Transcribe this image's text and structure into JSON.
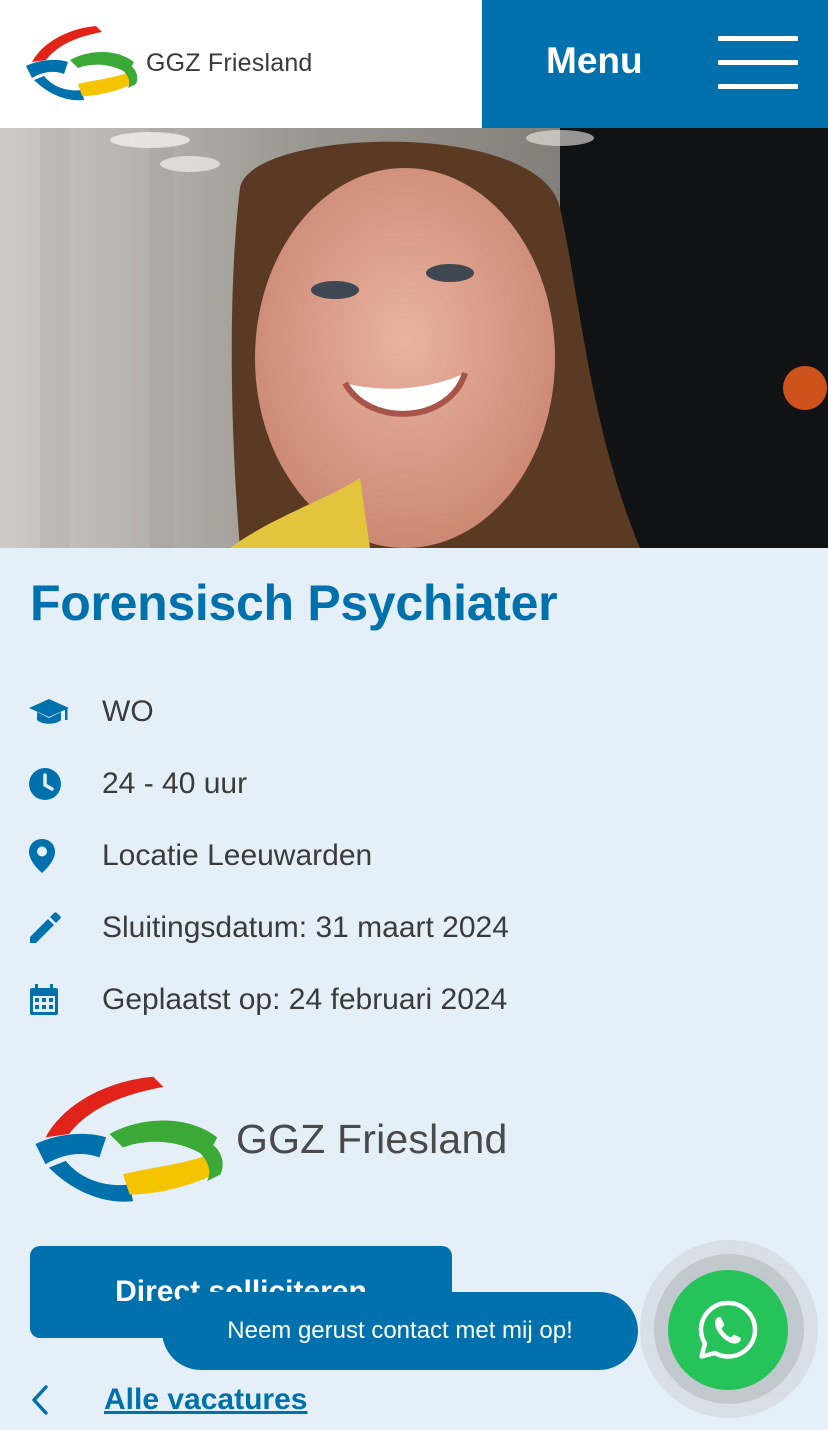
{
  "header": {
    "brand_name": "GGZ Friesland",
    "menu_label": "Menu"
  },
  "hero": {
    "image_description": "smiling-woman-portrait"
  },
  "job": {
    "title": "Forensisch Psychiater",
    "meta": [
      {
        "icon": "graduation-cap-icon",
        "text": "WO"
      },
      {
        "icon": "clock-icon",
        "text": "24 - 40 uur"
      },
      {
        "icon": "location-pin-icon",
        "text": "Locatie Leeuwarden"
      },
      {
        "icon": "pencil-icon",
        "text": "Sluitingsdatum: 31 maart 2024"
      },
      {
        "icon": "calendar-icon",
        "text": "Geplaatst op: 24 februari 2024"
      }
    ]
  },
  "company_logo_text": "GGZ Friesland",
  "apply_button_label": "Direct solliciteren",
  "back_link_label": "Alle vacatures",
  "chat": {
    "bubble_text": "Neem gerust contact met mij op!"
  },
  "colors": {
    "brand_blue": "#0071ad",
    "background": "#e5eff7",
    "whatsapp_green": "#25c35a",
    "logo_red": "#e2231a",
    "logo_blue": "#0071ad",
    "logo_green": "#3aa935",
    "logo_yellow": "#f5c400"
  }
}
